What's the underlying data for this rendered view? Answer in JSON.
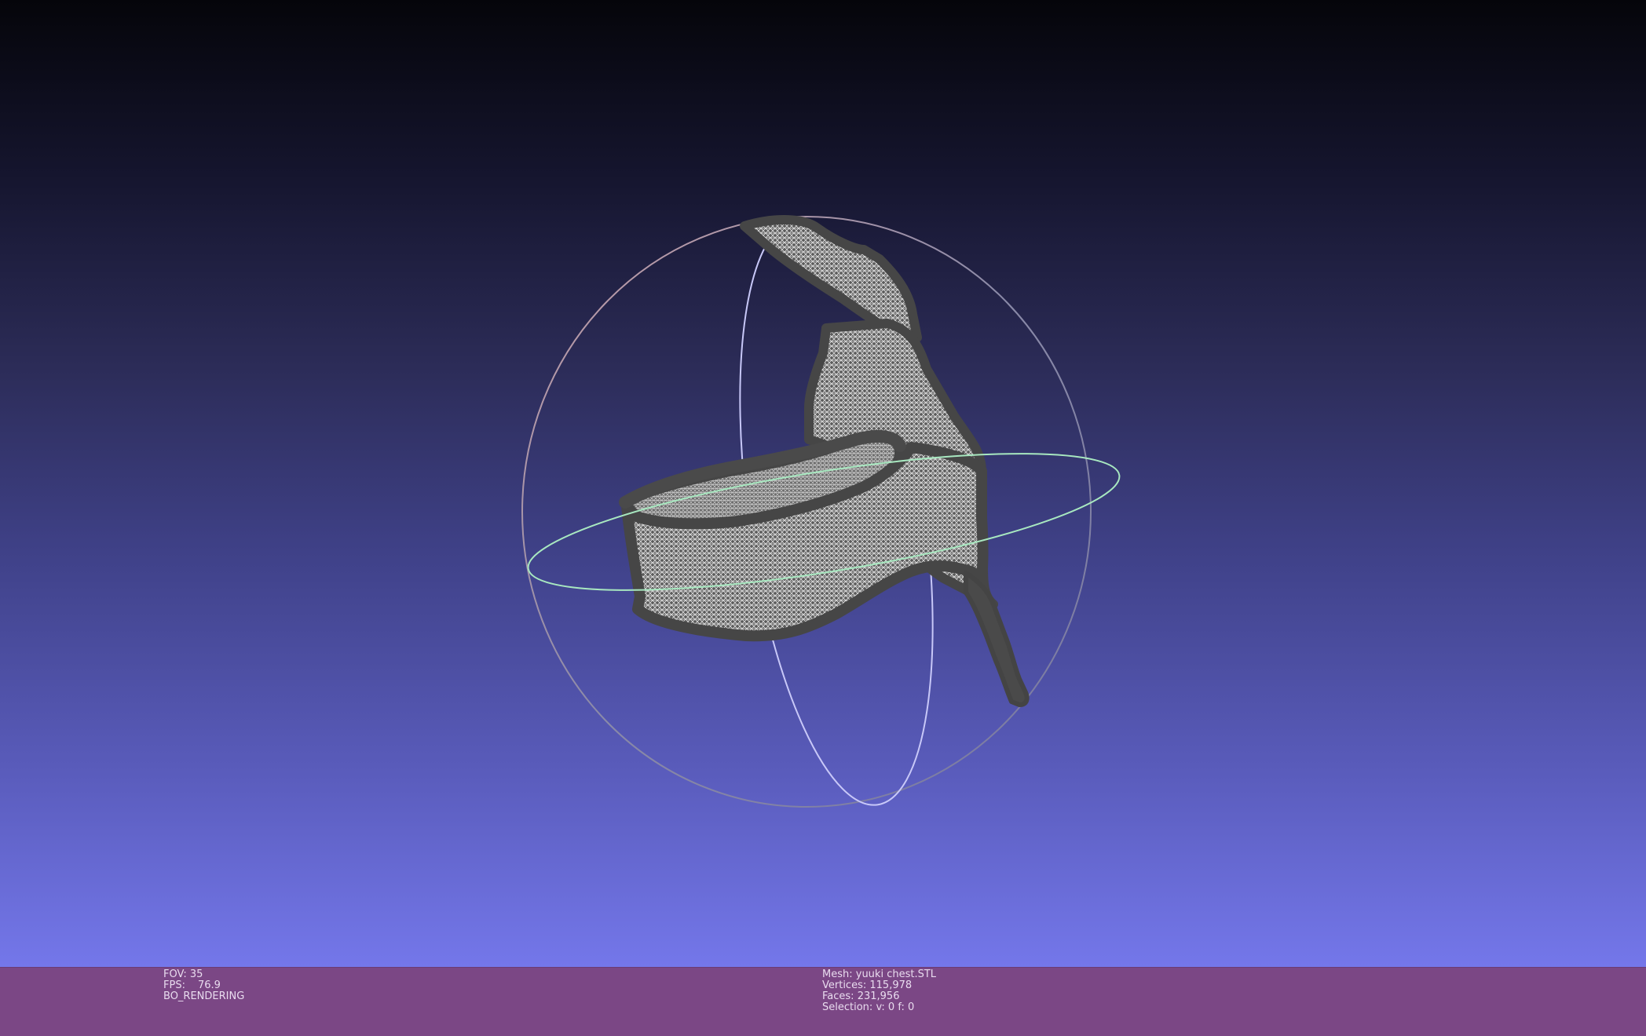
{
  "viewer": {
    "background_top": "#05050a",
    "background_bottom": "#7477ea",
    "mesh_color": "#4a4a4a",
    "wire_color": "#d8d8d8",
    "trackball": {
      "horizontal_ring_color": "#a8e8c0",
      "vertical_ring_color": "#c8c8f8",
      "outer_ring_color": "#b89aa8"
    }
  },
  "status_bar": {
    "color": "#7b4785",
    "view_info": {
      "fov_label": "FOV:",
      "fov_value": "35",
      "fps_label": "FPS:",
      "fps_value": "76.9",
      "render_mode": "BO_RENDERING"
    },
    "mesh_info": {
      "mesh_label": "Mesh:",
      "mesh_name": "yuuki chest.STL",
      "vertices_label": "Vertices:",
      "vertices_value": "115,978",
      "faces_label": "Faces:",
      "faces_value": "231,956",
      "selection_label": "Selection:",
      "selection_value": "v: 0 f: 0"
    }
  }
}
